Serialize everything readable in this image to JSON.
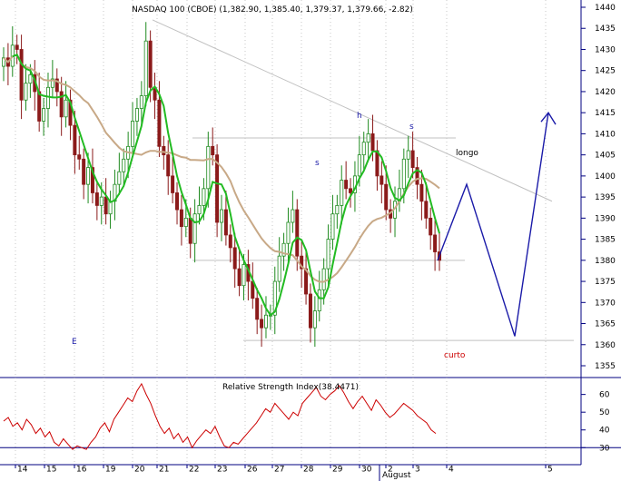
{
  "chart_data": [
    {
      "type": "candlestick",
      "title": "NASDAQ 100 (CBOE) (1,382.90, 1,385.40, 1,379.37, 1,379.66, -2.82)",
      "ylim": [
        1350,
        1444
      ],
      "y_ticks": [
        1355,
        1360,
        1365,
        1370,
        1375,
        1380,
        1385,
        1390,
        1395,
        1400,
        1405,
        1410,
        1415,
        1420,
        1425,
        1430,
        1435,
        1440
      ],
      "x_ticks": [
        "14",
        "15",
        "16",
        "19",
        "20",
        "21",
        "22",
        "23",
        "26",
        "27",
        "28",
        "29",
        "30",
        "2",
        "3",
        "4",
        "5"
      ],
      "x_month_label": "August",
      "grid": "vertical dotted",
      "candles_close": [
        1428,
        1426,
        1431,
        1430,
        1418,
        1422,
        1424,
        1420,
        1413,
        1416,
        1421,
        1423,
        1420,
        1414,
        1418,
        1412,
        1405,
        1404,
        1398,
        1402,
        1396,
        1393,
        1395,
        1391,
        1394,
        1398,
        1401,
        1404,
        1407,
        1413,
        1416,
        1419,
        1432,
        1421,
        1418,
        1407,
        1405,
        1400,
        1396,
        1392,
        1388,
        1390,
        1384,
        1391,
        1393,
        1397,
        1407,
        1405,
        1389,
        1392,
        1386,
        1383,
        1378,
        1374,
        1379,
        1375,
        1371,
        1366,
        1364,
        1367,
        1367,
        1375,
        1381,
        1384,
        1389,
        1392,
        1381,
        1378,
        1372,
        1364,
        1368,
        1373,
        1378,
        1385,
        1391,
        1393,
        1399,
        1397,
        1396,
        1400,
        1405,
        1408,
        1410,
        1406,
        1400,
        1398,
        1392,
        1390,
        1394,
        1397,
        1404,
        1406,
        1402,
        1398,
        1394,
        1390,
        1386,
        1382,
        1380
      ],
      "ma_fast": "green",
      "ma_slow": "tan",
      "annotations": [
        "h",
        "s",
        "s",
        "longo",
        "curto",
        "E"
      ]
    },
    {
      "type": "line",
      "title": "Relative Strength Index(38.4471)",
      "ylim": [
        24,
        68
      ],
      "y_ticks": [
        30,
        40,
        50,
        60
      ],
      "reference_line": 30,
      "values": [
        45,
        47,
        42,
        44,
        40,
        46,
        43,
        38,
        41,
        36,
        39,
        33,
        31,
        35,
        32,
        29,
        31,
        30,
        29,
        33,
        36,
        41,
        44,
        39,
        46,
        50,
        54,
        58,
        56,
        62,
        66,
        60,
        55,
        48,
        42,
        38,
        41,
        35,
        38,
        33,
        36,
        30,
        34,
        37,
        40,
        38,
        42,
        36,
        31,
        30,
        33,
        32,
        35,
        38,
        41,
        44,
        48,
        52,
        50,
        55,
        52,
        49,
        46,
        50,
        48,
        55,
        58,
        61,
        64,
        59,
        57,
        60,
        62,
        65,
        61,
        56,
        52,
        56,
        59,
        55,
        51,
        57,
        54,
        50,
        47,
        49,
        52,
        55,
        53,
        51,
        48,
        46,
        44,
        40,
        38
      ],
      "line_color": "#cc0000"
    }
  ],
  "colors": {
    "up": "#1f8a1f",
    "down": "#8b1a1a",
    "ma_fast": "#22bb22",
    "ma_slow": "#c8a987",
    "trend": "#c0c0c0",
    "projection": "#1a1aa8",
    "axis": "#000080",
    "label_red": "#cc0000"
  }
}
